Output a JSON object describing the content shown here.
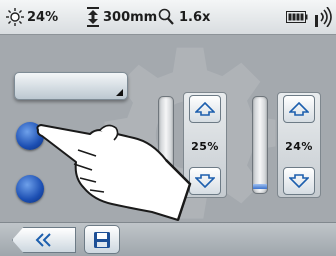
{
  "status_bar": {
    "brightness": "24%",
    "height": "300mm",
    "zoom": "1.6x",
    "icons": [
      "brightness-icon",
      "height-icon",
      "magnifier-icon",
      "battery-icon",
      "signal-icon"
    ]
  },
  "left_panel": {
    "dropdown_value": "",
    "radio_options": [
      {
        "icon": "radio-button",
        "selected": true
      },
      {
        "icon": "radio-button",
        "selected": false
      }
    ]
  },
  "sliders": [
    {
      "value_label": "25%",
      "level": 0.05
    },
    {
      "value_label": "24%",
      "level": 0.05
    }
  ],
  "bottom_bar": {
    "icons": [
      "back-icon",
      "save-icon"
    ]
  },
  "overlay": {
    "icon": "pointing-hand"
  },
  "colors": {
    "radio": "#2355c4",
    "accent": "#3d73cc",
    "background": "#a4a9ae"
  }
}
